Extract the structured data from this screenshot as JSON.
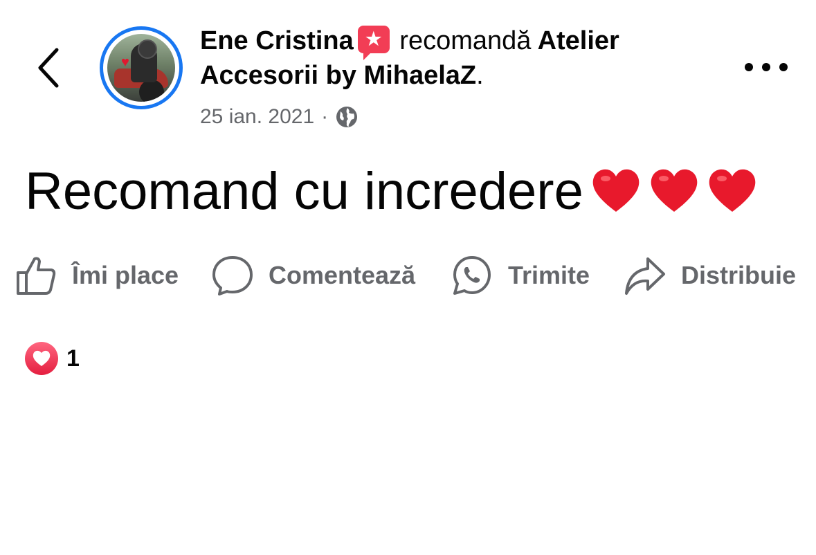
{
  "header": {
    "author_name": "Ene Cristina",
    "badge_icon": "recommend-star-icon",
    "action_text": "recomandă",
    "page_name": "Atelier Accesorii by MihaelaZ",
    "page_suffix": ".",
    "date": "25 ian. 2021",
    "separator": "·",
    "audience_icon": "globe-icon"
  },
  "post": {
    "text": "Recomand cu incredere",
    "emoji": "❤️❤️❤️"
  },
  "actions": {
    "like_label": "Îmi place",
    "comment_label": "Comentează",
    "send_label": "Trimite",
    "share_label": "Distribuie"
  },
  "reactions": {
    "icon": "love-reaction-icon",
    "count": "1"
  },
  "colors": {
    "accent_ring": "#1877f2",
    "badge": "#f23d55",
    "secondary_text": "#65676b",
    "heart": "#e41e3f"
  }
}
